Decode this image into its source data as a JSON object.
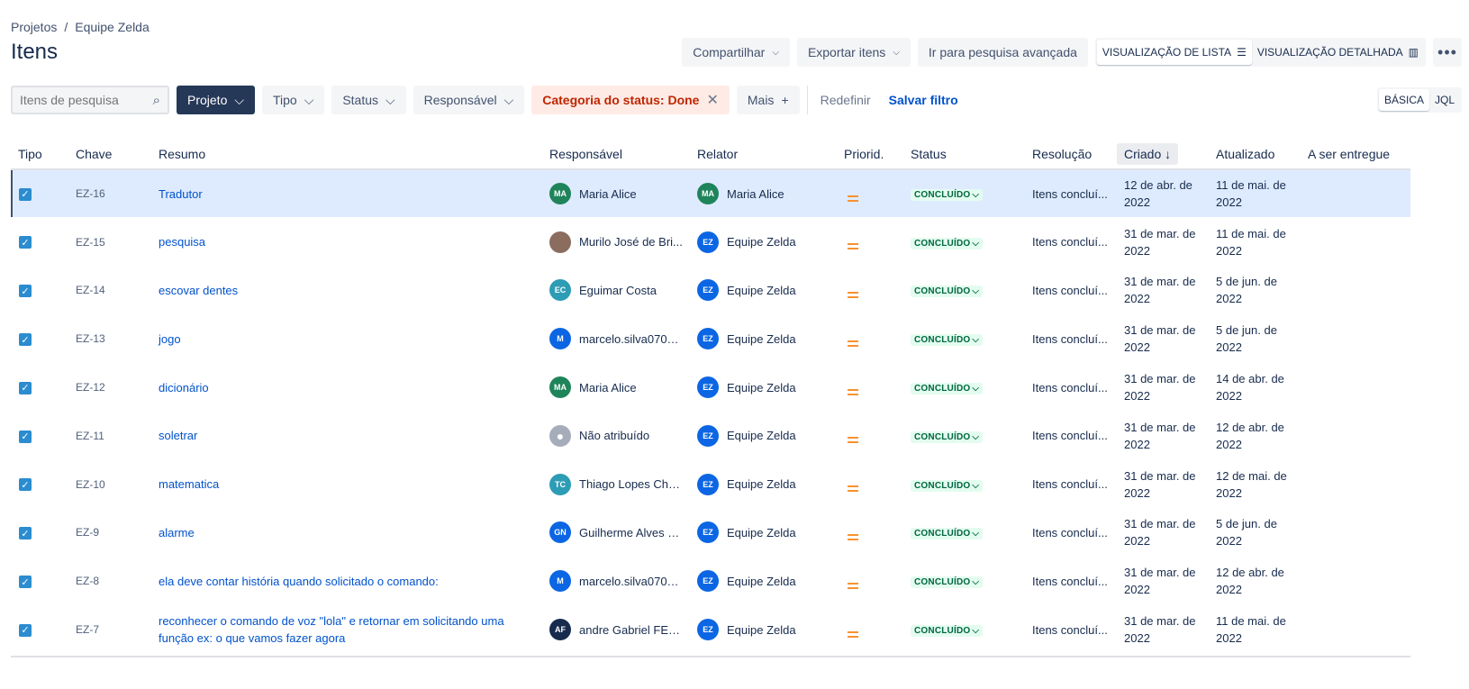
{
  "breadcrumb": {
    "projects": "Projetos",
    "separator": "/",
    "team": "Equipe Zelda"
  },
  "page_title": "Itens",
  "actions": {
    "share": "Compartilhar",
    "export": "Exportar itens",
    "advanced": "Ir para pesquisa avançada",
    "list_view": "VISUALIZAÇÃO DE LISTA",
    "detail_view": "VISUALIZAÇÃO DETALHADA",
    "more": "•••"
  },
  "filters": {
    "search_placeholder": "Itens de pesquisa",
    "project": "Projeto",
    "type": "Tipo",
    "status": "Status",
    "assignee": "Responsável",
    "status_category": "Categoria do status: Done",
    "more": "Mais",
    "reset": "Redefinir",
    "save": "Salvar filtro",
    "basic": "BÁSICA",
    "jql": "JQL"
  },
  "columns": {
    "type": "Tipo",
    "key": "Chave",
    "summary": "Resumo",
    "assignee": "Responsável",
    "reporter": "Relator",
    "priority": "Priorid.",
    "status": "Status",
    "resolution": "Resolução",
    "created": "Criado",
    "updated": "Atualizado",
    "due": "A ser entregue"
  },
  "colors": {
    "accent": "#0052cc",
    "selected_row": "#deebff",
    "status_done_bg": "#e3fcef",
    "status_done_fg": "#006644",
    "priority_medium": "#f79232"
  },
  "issues": [
    {
      "key": "EZ-16",
      "summary": "Tradutor",
      "assignee": "Maria Alice",
      "assignee_initials": "MA",
      "assignee_color": "#1f845a",
      "reporter": "Maria Alice",
      "reporter_initials": "MA",
      "reporter_color": "#1f845a",
      "status": "CONCLUÍDO",
      "resolution": "Itens concluí...",
      "created": "12 de abr. de 2022",
      "updated": "11 de mai. de 2022",
      "due": ""
    },
    {
      "key": "EZ-15",
      "summary": "pesquisa",
      "assignee": "Murilo José de Bri...",
      "assignee_initials": "",
      "assignee_color": "#8a6d5f",
      "reporter": "Equipe Zelda",
      "reporter_initials": "EZ",
      "reporter_color": "#0c66e4",
      "status": "CONCLUÍDO",
      "resolution": "Itens concluí...",
      "created": "31 de mar. de 2022",
      "updated": "11 de mai. de 2022",
      "due": ""
    },
    {
      "key": "EZ-14",
      "summary": "escovar dentes",
      "assignee": "Eguimar Costa",
      "assignee_initials": "EC",
      "assignee_color": "#2d9cb5",
      "reporter": "Equipe Zelda",
      "reporter_initials": "EZ",
      "reporter_color": "#0c66e4",
      "status": "CONCLUÍDO",
      "resolution": "Itens concluí...",
      "created": "31 de mar. de 2022",
      "updated": "5 de jun. de 2022",
      "due": ""
    },
    {
      "key": "EZ-13",
      "summary": "jogo",
      "assignee": "marcelo.silva0708...",
      "assignee_initials": "M",
      "assignee_color": "#0c66e4",
      "reporter": "Equipe Zelda",
      "reporter_initials": "EZ",
      "reporter_color": "#0c66e4",
      "status": "CONCLUÍDO",
      "resolution": "Itens concluí...",
      "created": "31 de mar. de 2022",
      "updated": "5 de jun. de 2022",
      "due": ""
    },
    {
      "key": "EZ-12",
      "summary": "dicionário",
      "assignee": "Maria Alice",
      "assignee_initials": "MA",
      "assignee_color": "#1f845a",
      "reporter": "Equipe Zelda",
      "reporter_initials": "EZ",
      "reporter_color": "#0c66e4",
      "status": "CONCLUÍDO",
      "resolution": "Itens concluí...",
      "created": "31 de mar. de 2022",
      "updated": "14 de abr. de 2022",
      "due": ""
    },
    {
      "key": "EZ-11",
      "summary": "soletrar",
      "assignee": "Não atribuído",
      "assignee_initials": "",
      "assignee_color": "#a5adba",
      "reporter": "Equipe Zelda",
      "reporter_initials": "EZ",
      "reporter_color": "#0c66e4",
      "status": "CONCLUÍDO",
      "resolution": "Itens concluí...",
      "created": "31 de mar. de 2022",
      "updated": "12 de abr. de 2022",
      "due": ""
    },
    {
      "key": "EZ-10",
      "summary": "matematica",
      "assignee": "Thiago Lopes Cha...",
      "assignee_initials": "TC",
      "assignee_color": "#2d9cb5",
      "reporter": "Equipe Zelda",
      "reporter_initials": "EZ",
      "reporter_color": "#0c66e4",
      "status": "CONCLUÍDO",
      "resolution": "Itens concluí...",
      "created": "31 de mar. de 2022",
      "updated": "12 de mai. de 2022",
      "due": ""
    },
    {
      "key": "EZ-9",
      "summary": "alarme",
      "assignee": "Guilherme Alves d...",
      "assignee_initials": "GN",
      "assignee_color": "#0c66e4",
      "reporter": "Equipe Zelda",
      "reporter_initials": "EZ",
      "reporter_color": "#0c66e4",
      "status": "CONCLUÍDO",
      "resolution": "Itens concluí...",
      "created": "31 de mar. de 2022",
      "updated": "5 de jun. de 2022",
      "due": ""
    },
    {
      "key": "EZ-8",
      "summary": "ela deve contar história quando solicitado o comando:",
      "assignee": "marcelo.silva0708...",
      "assignee_initials": "M",
      "assignee_color": "#0c66e4",
      "reporter": "Equipe Zelda",
      "reporter_initials": "EZ",
      "reporter_color": "#0c66e4",
      "status": "CONCLUÍDO",
      "resolution": "Itens concluí...",
      "created": "31 de mar. de 2022",
      "updated": "12 de abr. de 2022",
      "due": ""
    },
    {
      "key": "EZ-7",
      "summary": "reconhecer o comando de voz \"lola\" e retornar em solicitando uma função ex: o que vamos fazer agora",
      "assignee": "andre Gabriel FER...",
      "assignee_initials": "AF",
      "assignee_color": "#172b4d",
      "reporter": "Equipe Zelda",
      "reporter_initials": "EZ",
      "reporter_color": "#0c66e4",
      "status": "CONCLUÍDO",
      "resolution": "Itens concluí...",
      "created": "31 de mar. de 2022",
      "updated": "11 de mai. de 2022",
      "due": ""
    }
  ]
}
